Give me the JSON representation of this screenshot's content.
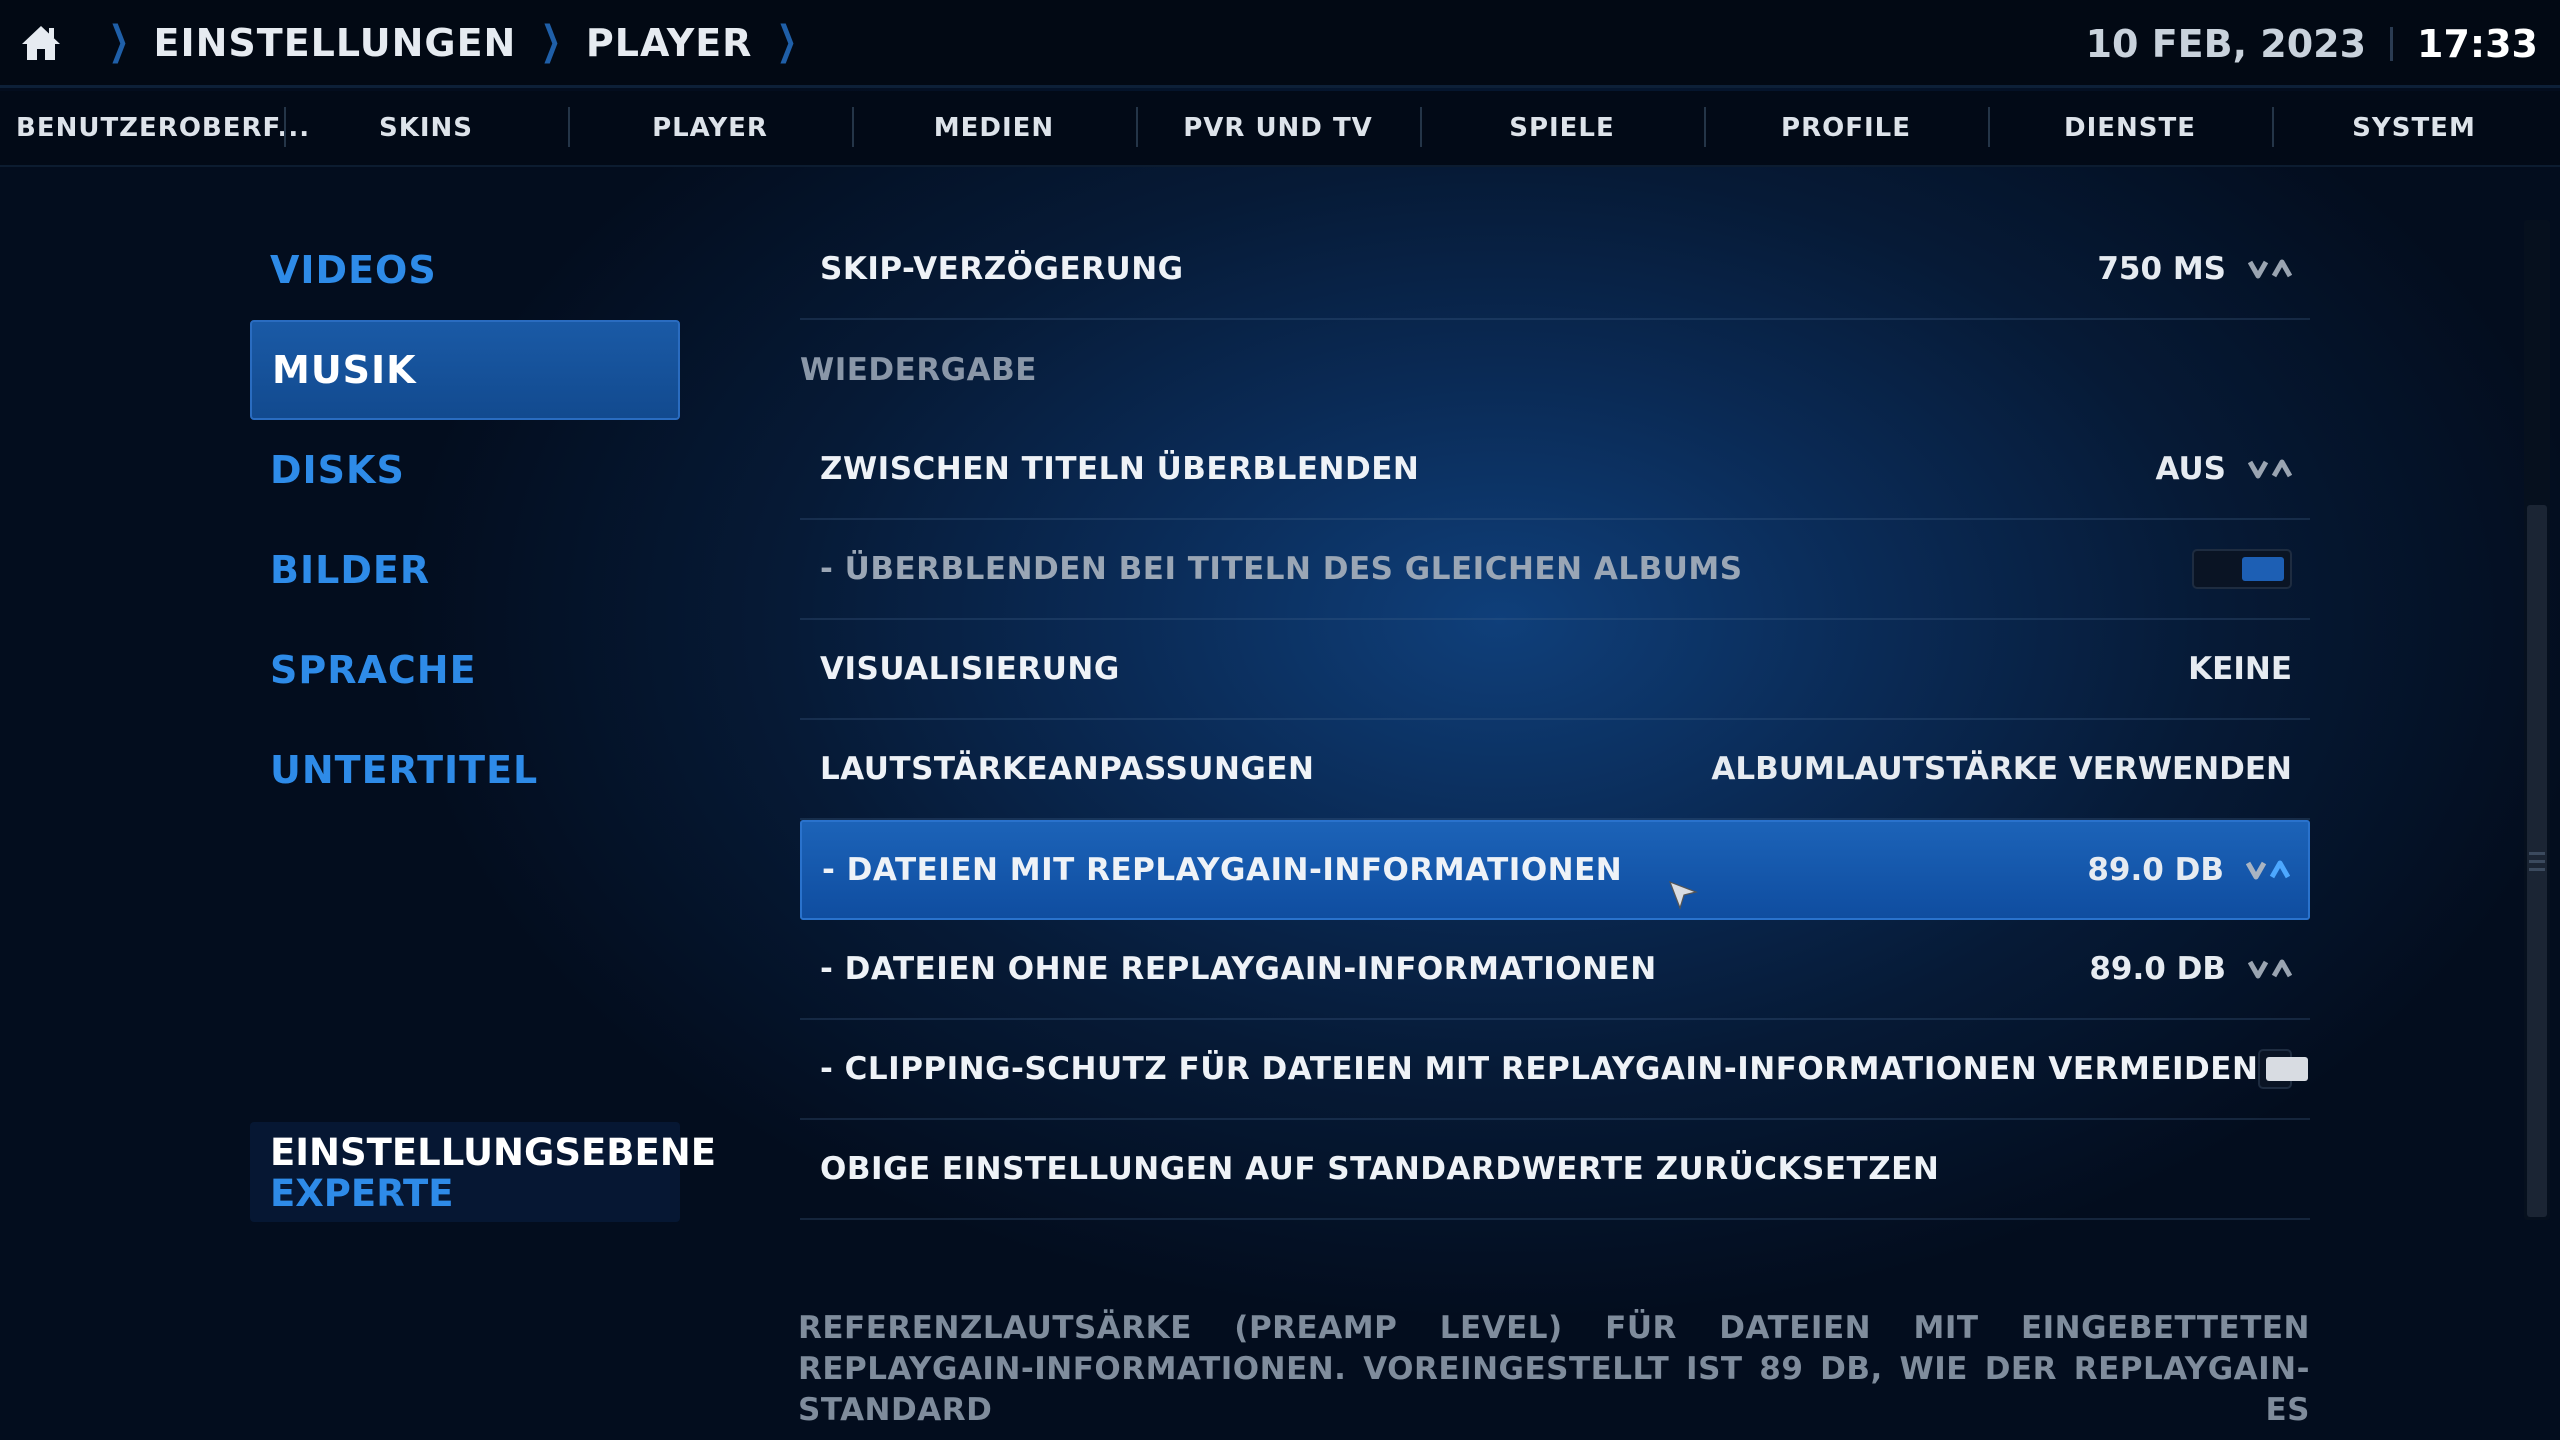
{
  "breadcrumb": {
    "items": [
      "EINSTELLUNGEN",
      "PLAYER"
    ]
  },
  "clock": {
    "date": "10 FEB, 2023",
    "time": "17:33"
  },
  "tabs": [
    "BENUTZEROBERF...",
    "SKINS",
    "PLAYER",
    "MEDIEN",
    "PVR UND TV",
    "SPIELE",
    "PROFILE",
    "DIENSTE",
    "SYSTEM"
  ],
  "sidebar": {
    "items": [
      "VIDEOS",
      "MUSIK",
      "DISKS",
      "BILDER",
      "SPRACHE",
      "UNTERTITEL"
    ],
    "active": "MUSIK"
  },
  "settings_level": {
    "title": "EINSTELLUNGSEBENE",
    "value": "EXPERTE"
  },
  "settings": {
    "skip_delay": {
      "label": "SKIP-VERZÖGERUNG",
      "value": "750 MS"
    },
    "section_playback": "WIEDERGABE",
    "crossfade": {
      "label": "ZWISCHEN TITELN ÜBERBLENDEN",
      "value": "AUS"
    },
    "crossfade_album": {
      "label": "- ÜBERBLENDEN BEI TITELN DES GLEICHEN ALBUMS",
      "enabled": true
    },
    "visualization": {
      "label": "VISUALISIERUNG",
      "value": "KEINE"
    },
    "volume_adjust": {
      "label": "LAUTSTÄRKEANPASSUNGEN",
      "value": "ALBUMLAUTSTÄRKE VERWENDEN"
    },
    "with_replaygain": {
      "label": "- DATEIEN MIT REPLAYGAIN-INFORMATIONEN",
      "value": "89.0 DB"
    },
    "without_replaygain": {
      "label": "- DATEIEN OHNE REPLAYGAIN-INFORMATIONEN",
      "value": "89.0 DB"
    },
    "clipping": {
      "label": "- CLIPPING-SCHUTZ FÜR DATEIEN MIT REPLAYGAIN-INFORMATIONEN VERMEIDEN",
      "enabled": false
    },
    "reset": {
      "label": "OBIGE EINSTELLUNGEN AUF STANDARDWERTE ZURÜCKSETZEN"
    }
  },
  "description": "REFERENZLAUTSÄRKE (PREAMP LEVEL) FÜR DATEIEN MIT EINGEBETTETEN REPLAYGAIN-INFORMATIONEN. VOREINGESTELLT IST 89 DB, WIE DER REPLAYGAIN-STANDARD ES",
  "colors": {
    "accent": "#2e8be8",
    "selection": "#1c63b8",
    "background": "#061a36"
  }
}
